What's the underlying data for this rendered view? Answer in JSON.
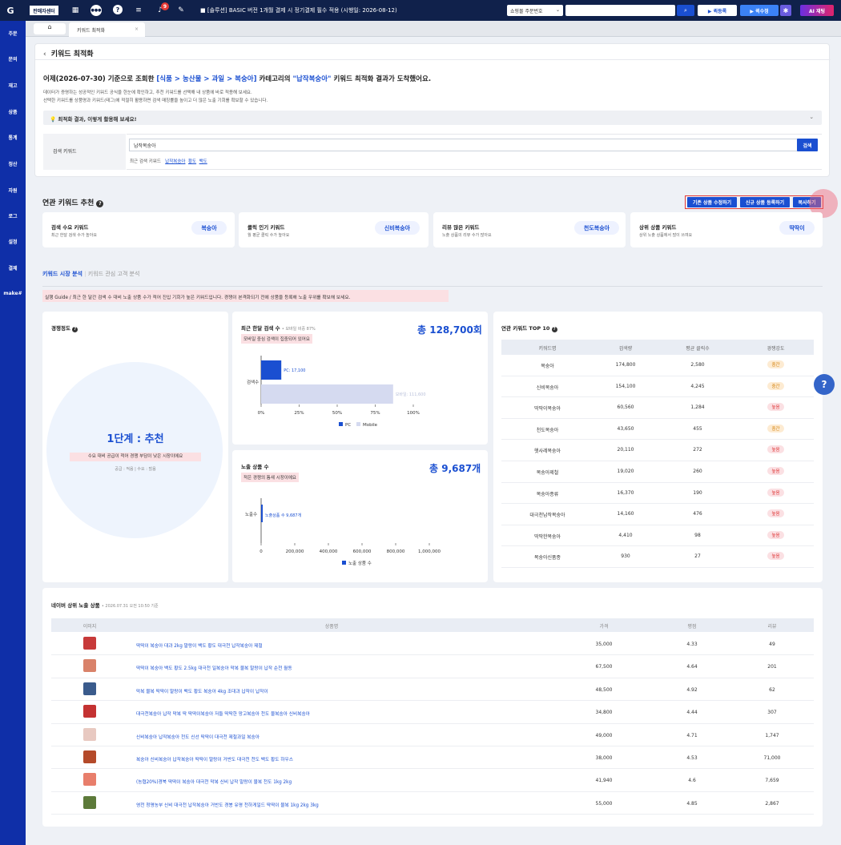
{
  "topbar": {
    "brand": "판매자센터",
    "badge_count": "9",
    "notice": "■ [솔루션] BASIC 버전 1개월 결제 시 정기결제 필수 적용 (시행일: 2026-08-12)",
    "order_select": "쇼핑몰 주문번호",
    "btn_register": "▶ 퀵등록",
    "btn_modify": "▶ 퀵수정",
    "btn_ai": "AI 재팅"
  },
  "sidebar": {
    "items": [
      "주문",
      "문의",
      "재고",
      "상품",
      "통계",
      "정산",
      "자원",
      "로그",
      "설정",
      "결제",
      "make#"
    ]
  },
  "tabs": {
    "current": "키워드 최적화"
  },
  "page": {
    "title": "키워드 최적화",
    "headline_pre": "어제(2026-07-30) 기준으로 조회한 ",
    "headline_cat": "[식품 > 농산물 > 과일 > 복숭아]",
    "headline_mid": " 카테고리의 ",
    "headline_kw": "\"납작복숭아\"",
    "headline_post": " 키워드 최적화 결과가 도착했어요.",
    "desc1": "데이터가 증명하는 성공적인 키워드 공식을 한눈에 확인하고, 추천 키워드를 선택해 내 상품에 바로 적용해 보세요.",
    "desc2": "선택한 키워드를 상품명과 키워드(태그)에 적절히 활용하면 검색 매칭률을 높이고 더 많은 노출 기회를 확보할 수 있습니다.",
    "tip": "최적화 결과, 이렇게 활용해 보세요!",
    "search_label": "검색 키워드",
    "search_value": "납작복숭아",
    "search_btn": "검색",
    "recent_label": "최근 검색 키워드",
    "recent": [
      "납작복숭아",
      "황도",
      "백도"
    ]
  },
  "related": {
    "title": "연관 키워드 추천",
    "btn_existing": "기존 상품 수정하기",
    "btn_new": "신규 상품 등록하기",
    "btn_copy": "복사하기",
    "cards": [
      {
        "title": "검색 수요 키워드",
        "sub": "최근 한달 검색 수가 높아요",
        "kw": "복숭아"
      },
      {
        "title": "클릭 인기 키워드",
        "sub": "월 평균 클릭 수가 높아요",
        "kw": "신비복숭아"
      },
      {
        "title": "리뷰 많은 키워드",
        "sub": "노출 상품의 리뷰 수가 많아요",
        "kw": "천도복숭아"
      },
      {
        "title": "상위 상품 키워드",
        "sub": "상위 노출 상품에서 많이 쓰여요",
        "kw": "딱딱이"
      }
    ]
  },
  "analysis_tabs": {
    "active": "키워드 시장 분석",
    "inactive": "키워드 관심 고객 분석"
  },
  "guide": "실행 Guide / 최근 한 달간 검색 수 대비 노출 상품 수가 적어 진입 기회가 높은 키워드입니다. 경쟁이 본격화되기 전에 상품을 등록해 노출 우위를 확보해 보세요.",
  "competition": {
    "title": "경쟁정도",
    "level": "1단계 : 추천",
    "desc": "수요 대비 공급이 적어 경쟁 부담이 낮은 시장이에요",
    "sub": "공급 : 적음 | 수요 : 많음"
  },
  "search_volume": {
    "title": "최근 한달 검색 수",
    "mobile_ratio": "• 모바일 비중 87%",
    "total": "총 128,700회",
    "note": "모바일 중심 검색이 집중되어 있어요",
    "row_label": "검색수",
    "pc_label": "PC: 17,100",
    "mobile_label": "모바일: 111,600",
    "pc_value": 17100,
    "mobile_value": 111600,
    "ticks": [
      "0%",
      "25%",
      "50%",
      "75%",
      "100%"
    ],
    "legend_pc": "PC",
    "legend_mobile": "Mobile"
  },
  "exposure": {
    "title": "노출 상품 수",
    "total": "총 9,687개",
    "note": "적은 경쟁의 틈새 시장이에요",
    "row_label": "노출수",
    "bar_label": "노출상품 수 9,687개",
    "value": 9687,
    "max": 1000000,
    "ticks": [
      "0",
      "200,000",
      "400,000",
      "600,000",
      "800,000",
      "1,000,000"
    ],
    "legend": "노출 상품 수"
  },
  "top10": {
    "title": "연관 키워드 TOP 10",
    "headers": [
      "키워드명",
      "검색량",
      "평균 클릭수",
      "경쟁강도"
    ],
    "rows": [
      {
        "kw": "복숭아",
        "vol": "174,800",
        "click": "2,580",
        "level": "중간"
      },
      {
        "kw": "신비복숭아",
        "vol": "154,100",
        "click": "4,245",
        "level": "중간"
      },
      {
        "kw": "딱딱이복숭아",
        "vol": "60,560",
        "click": "1,284",
        "level": "높음"
      },
      {
        "kw": "천도복숭아",
        "vol": "43,650",
        "click": "455",
        "level": "중간"
      },
      {
        "kw": "햇사레복숭아",
        "vol": "20,110",
        "click": "272",
        "level": "높음"
      },
      {
        "kw": "복숭아제철",
        "vol": "19,020",
        "click": "260",
        "level": "높음"
      },
      {
        "kw": "복숭아종류",
        "vol": "16,370",
        "click": "190",
        "level": "높음"
      },
      {
        "kw": "대극천납작복숭아",
        "vol": "14,160",
        "click": "476",
        "level": "높음"
      },
      {
        "kw": "딱딱한복숭아",
        "vol": "4,410",
        "click": "98",
        "level": "높음"
      },
      {
        "kw": "복숭아신품종",
        "vol": "930",
        "click": "27",
        "level": "높음"
      }
    ]
  },
  "naver": {
    "title": "네이버 상위 노출 상품",
    "date": "• 2026.07.31 오전 10:50 기준",
    "headers": [
      "이미지",
      "상품명",
      "가격",
      "평점",
      "리뷰"
    ],
    "rows": [
      {
        "name": "딱딱이 복숭아 대과 2kg 말랑이 백도 황도 대극천 납작복숭아 제철",
        "price": "35,000",
        "rating": "4.33",
        "review": "49"
      },
      {
        "name": "딱딱이 복숭아 백도 황도 2.5kg 대극천 일복숭아 막복 물복 말랑이 납작 순천 월동",
        "price": "67,500",
        "rating": "4.64",
        "review": "201"
      },
      {
        "name": "막복 물복 딱딱이 말랑이 백도 황도 복숭아 4kg 조대과 납작이 납작이",
        "price": "48,500",
        "rating": "4.92",
        "review": "62"
      },
      {
        "name": "대극천복숭아 납작 막복 딱 딱딱이복숭아 저들 딱딱한 망고복숭아 천도 물복숭아 신비복숭아",
        "price": "34,800",
        "rating": "4.44",
        "review": "307"
      },
      {
        "name": "신비복숭아 납작복숭아 천도 신선 딱딱이 대극천 제철과일 복숭아",
        "price": "49,000",
        "rating": "4.71",
        "review": "1,747"
      },
      {
        "name": "복숭아 신비복숭아 납작복숭아 딱딱이 말랑이 거반도 대극천 천도 백도 황도 하우스",
        "price": "38,000",
        "rating": "4.53",
        "review": "71,000"
      },
      {
        "name": "(농협20%)경북 딱딱이 복숭아 대극천 막복 신비 납작 말랑이 물복 천도 1kg 2kg",
        "price": "41,940",
        "rating": "4.6",
        "review": "7,659"
      },
      {
        "name": "영천 청명농부 신비 대극천 납작복숭아 거반도 경봉 유명 천하게일드 딱딱이 물복 1kg 2kg 3kg",
        "price": "55,000",
        "rating": "4.85",
        "review": "2,867"
      }
    ]
  },
  "colors": {
    "accent": "#1a4fd1",
    "nav": "#10214b",
    "side": "#0f2fa8",
    "mobile": "#d5daf0",
    "danger": "#d33"
  }
}
